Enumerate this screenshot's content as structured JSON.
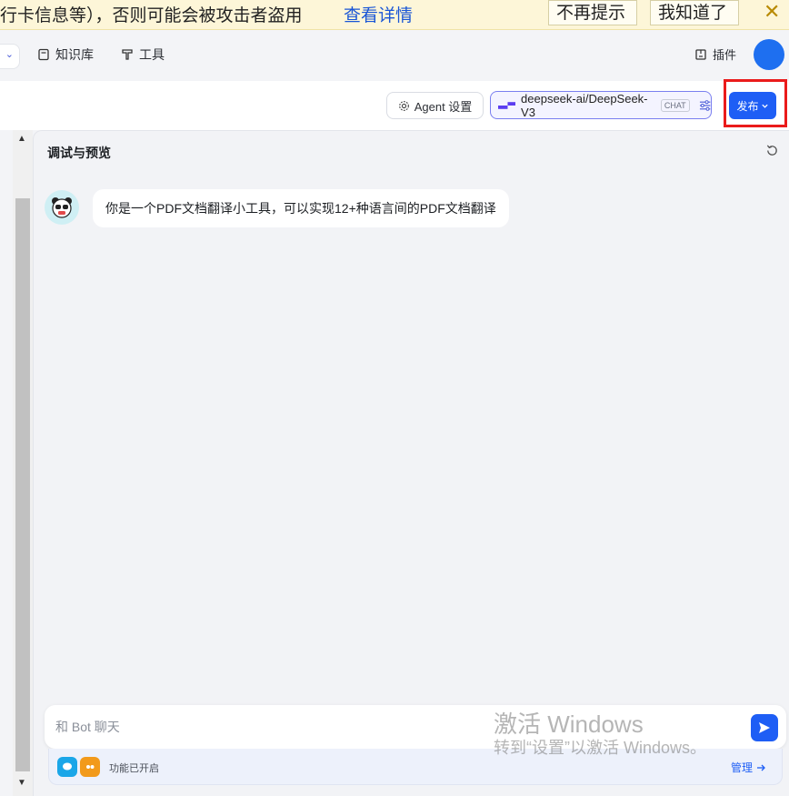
{
  "banner": {
    "text": "行卡信息等），否则可能会被攻击者盗用",
    "link": "查看详情",
    "dont_show": "不再提示",
    "got_it": "我知道了",
    "close": "✕"
  },
  "nav": {
    "knowledge": "知识库",
    "tools": "工具",
    "plugin": "插件"
  },
  "toolbar": {
    "agent_settings": "Agent 设置",
    "model_name": "deepseek-ai/DeepSeek-V3",
    "model_tag": "CHAT",
    "publish": "发布"
  },
  "preview": {
    "title": "调试与预览",
    "message": "你是一个PDF文档翻译小工具，可以实现12+种语言间的PDF文档翻译"
  },
  "chat_input": {
    "placeholder": "和 Bot 聊天"
  },
  "features": {
    "label": "功能已开启",
    "manage": "管理"
  },
  "watermark": {
    "line1": "激活 Windows",
    "line2": "转到“设置”以激活 Windows。"
  },
  "colors": {
    "accent": "#1e5ef5",
    "highlight_box": "#ea1b1b",
    "banner_bg": "#fdf6d8"
  }
}
